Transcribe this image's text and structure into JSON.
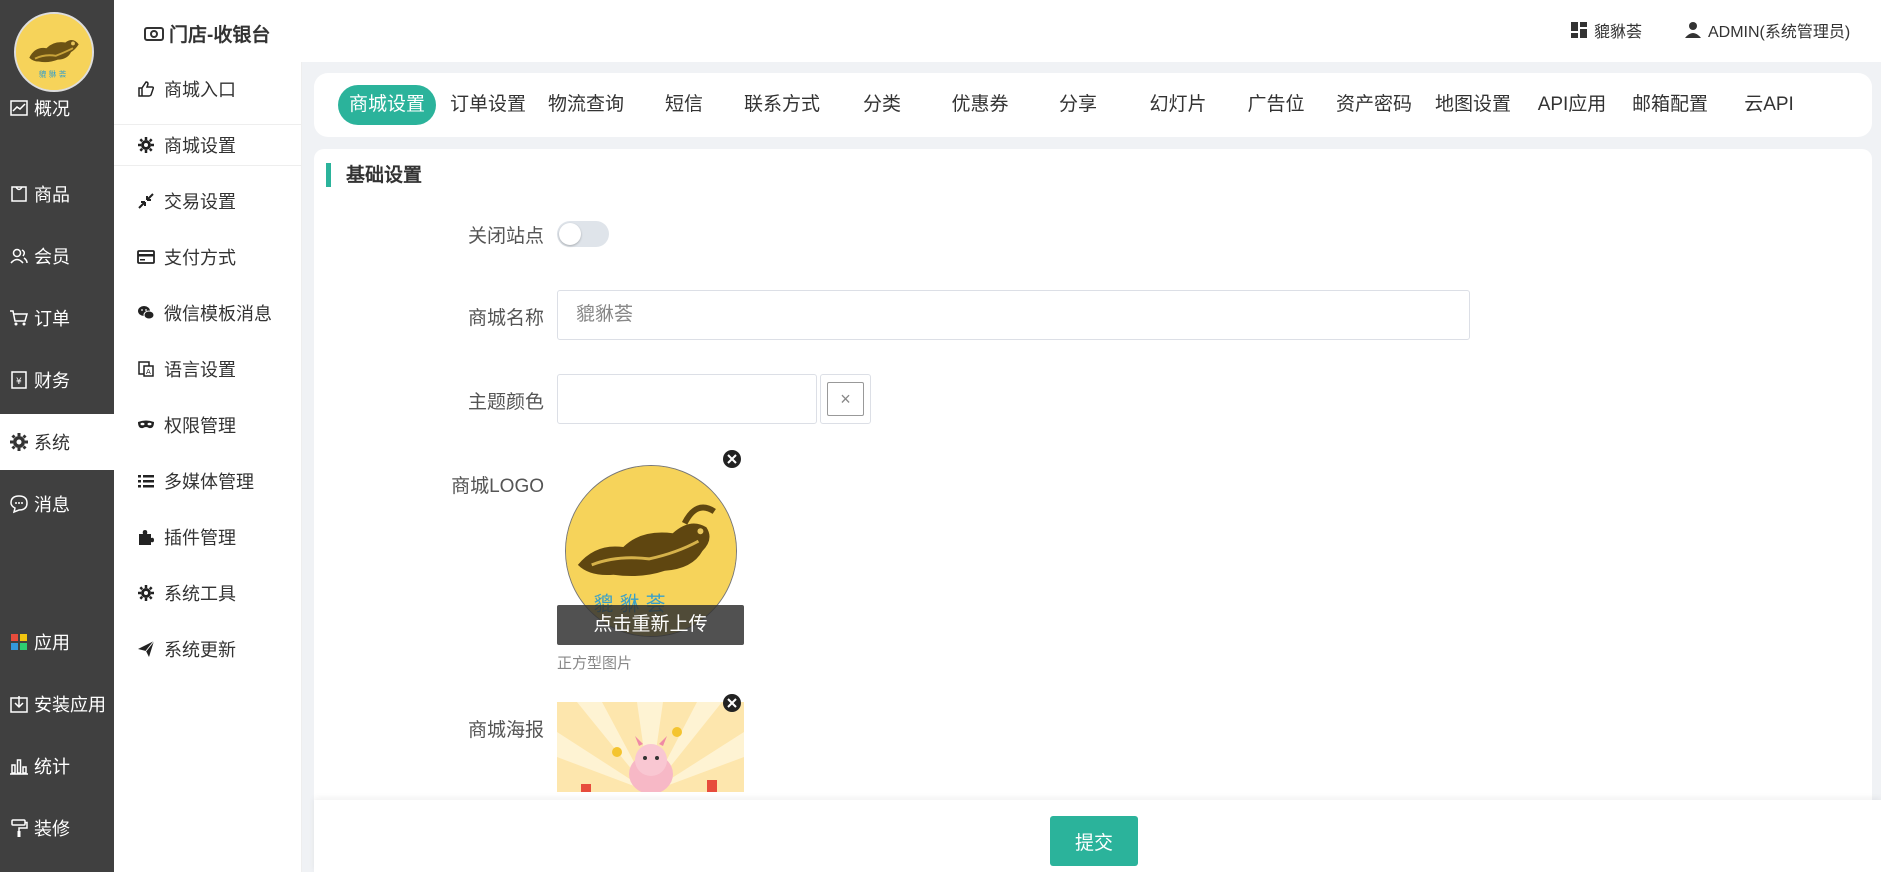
{
  "header": {
    "title": "门店-收银台",
    "shop_name": "貔貅荟",
    "user": "ADMIN(系统管理员)"
  },
  "main_nav": [
    {
      "label": "概况",
      "icon": "chart-icon"
    },
    {
      "label": "商品",
      "icon": "product-icon"
    },
    {
      "label": "会员",
      "icon": "users-icon"
    },
    {
      "label": "订单",
      "icon": "cart-icon"
    },
    {
      "label": "财务",
      "icon": "finance-icon"
    },
    {
      "label": "系统",
      "icon": "gear-icon",
      "active": true
    },
    {
      "label": "消息",
      "icon": "message-icon"
    },
    {
      "label": "应用",
      "icon": "apps-icon"
    },
    {
      "label": "安装应用",
      "icon": "install-icon"
    },
    {
      "label": "统计",
      "icon": "stats-icon"
    },
    {
      "label": "装修",
      "icon": "paint-roller-icon"
    }
  ],
  "sub_nav": [
    {
      "label": "商城入口",
      "icon": "thumb-icon"
    },
    {
      "label": "商城设置",
      "icon": "gear-icon",
      "active": true
    },
    {
      "label": "交易设置",
      "icon": "arrows-icon"
    },
    {
      "label": "支付方式",
      "icon": "card-icon"
    },
    {
      "label": "微信模板消息",
      "icon": "wechat-icon"
    },
    {
      "label": "语言设置",
      "icon": "language-icon"
    },
    {
      "label": "权限管理",
      "icon": "mask-icon"
    },
    {
      "label": "多媒体管理",
      "icon": "list-icon"
    },
    {
      "label": "插件管理",
      "icon": "puzzle-icon"
    },
    {
      "label": "系统工具",
      "icon": "gear-icon"
    },
    {
      "label": "系统更新",
      "icon": "send-icon"
    }
  ],
  "tabs": [
    {
      "label": "商城设置",
      "active": true
    },
    {
      "label": "订单设置"
    },
    {
      "label": "物流查询"
    },
    {
      "label": "短信"
    },
    {
      "label": "联系方式"
    },
    {
      "label": "分类"
    },
    {
      "label": "优惠券"
    },
    {
      "label": "分享"
    },
    {
      "label": "幻灯片"
    },
    {
      "label": "广告位"
    },
    {
      "label": "资产密码"
    },
    {
      "label": "地图设置"
    },
    {
      "label": "API应用"
    },
    {
      "label": "邮箱配置"
    },
    {
      "label": "云API"
    }
  ],
  "form": {
    "section_title": "基础设置",
    "close_site_label": "关闭站点",
    "close_site_on": false,
    "shop_name_label": "商城名称",
    "shop_name_placeholder": "貔貅荟",
    "theme_color_label": "主题颜色",
    "theme_color_clear": "×",
    "logo_label": "商城LOGO",
    "logo_reupload": "点击重新上传",
    "logo_hint": "正方型图片",
    "poster_label": "商城海报"
  },
  "footer": {
    "submit_label": "提交"
  },
  "colors": {
    "accent": "#2bb39b",
    "sidebar_bg": "#404040"
  }
}
